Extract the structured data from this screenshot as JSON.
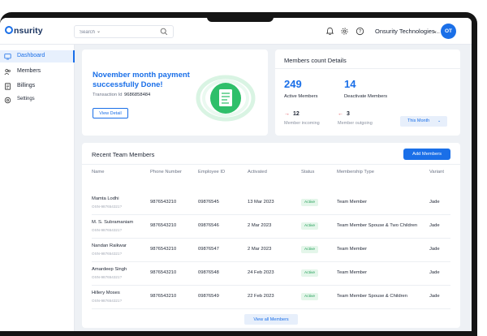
{
  "app": {
    "logo_text": "nsurity",
    "logo_mark": "O"
  },
  "topbar": {
    "search_placeholder": "Search",
    "org_name": "Onsurity Technologies...",
    "avatar_initials": "OT",
    "icons": [
      "bell-icon",
      "gear-icon",
      "help-icon"
    ]
  },
  "sidebar": {
    "items": [
      {
        "label": "Dashboard",
        "icon": "dashboard-icon",
        "active": true
      },
      {
        "label": "Members",
        "icon": "members-icon"
      },
      {
        "label": "Billings",
        "icon": "billings-icon"
      },
      {
        "label": "Settings",
        "icon": "settings-icon"
      }
    ]
  },
  "payment": {
    "title": "November month payment successfully Done!",
    "txn_label": "Transaction Id",
    "txn_id": "9686858484",
    "button": "View Detail"
  },
  "members_count": {
    "title": "Members count Details",
    "active_count": "249",
    "active_label": "Active Members",
    "deactive_count": "14",
    "deactive_label": "Deactivate Members",
    "incoming_count": "12",
    "incoming_label": "Member incoming",
    "outgoing_count": "3",
    "outgoing_label": "Member outgoing",
    "period": "This Month"
  },
  "team": {
    "title": "Recent Team Members",
    "add_button": "Add Members",
    "view_all": "View all Members",
    "columns": [
      "Name",
      "Phone Number",
      "Employee ID",
      "Activated",
      "Status",
      "Membership Type",
      "Variant"
    ],
    "rows": [
      {
        "name": "Mamta Lodhi",
        "osn": "OSN-987654321?",
        "phone": "9876543210",
        "emp_id": "09876545",
        "activated": "13 Mar 2023",
        "status": "Active",
        "type": "Team Member",
        "variant": "Jade"
      },
      {
        "name": "M. S. Subramaniam",
        "osn": "OSN-987654321?",
        "phone": "9876543210",
        "emp_id": "09876546",
        "activated": "2 Mar 2023",
        "status": "Active",
        "type": "Team Member Spouse & Two Children",
        "variant": "Jade"
      },
      {
        "name": "Nandan Raikwar",
        "osn": "OSN-987654321?",
        "phone": "9876543210",
        "emp_id": "09876547",
        "activated": "2 Mar 2023",
        "status": "Active",
        "type": "Team Member",
        "variant": "Jade"
      },
      {
        "name": "Amardeep Singh",
        "osn": "OSN-987654321?",
        "phone": "9876543210",
        "emp_id": "09876548",
        "activated": "24 Feb 2023",
        "status": "Active",
        "type": "Team Member",
        "variant": "Jade"
      },
      {
        "name": "Hillery Moses",
        "osn": "OSN-987654321?",
        "phone": "9876543210",
        "emp_id": "09876549",
        "activated": "22 Feb 2023",
        "status": "Active",
        "type": "Team Member Spouse & Children",
        "variant": "Jade"
      }
    ]
  },
  "colors": {
    "accent": "#1a6fe8",
    "success": "#1f9d55",
    "illustration": "#2fbf6a",
    "danger": "#e0484f"
  }
}
